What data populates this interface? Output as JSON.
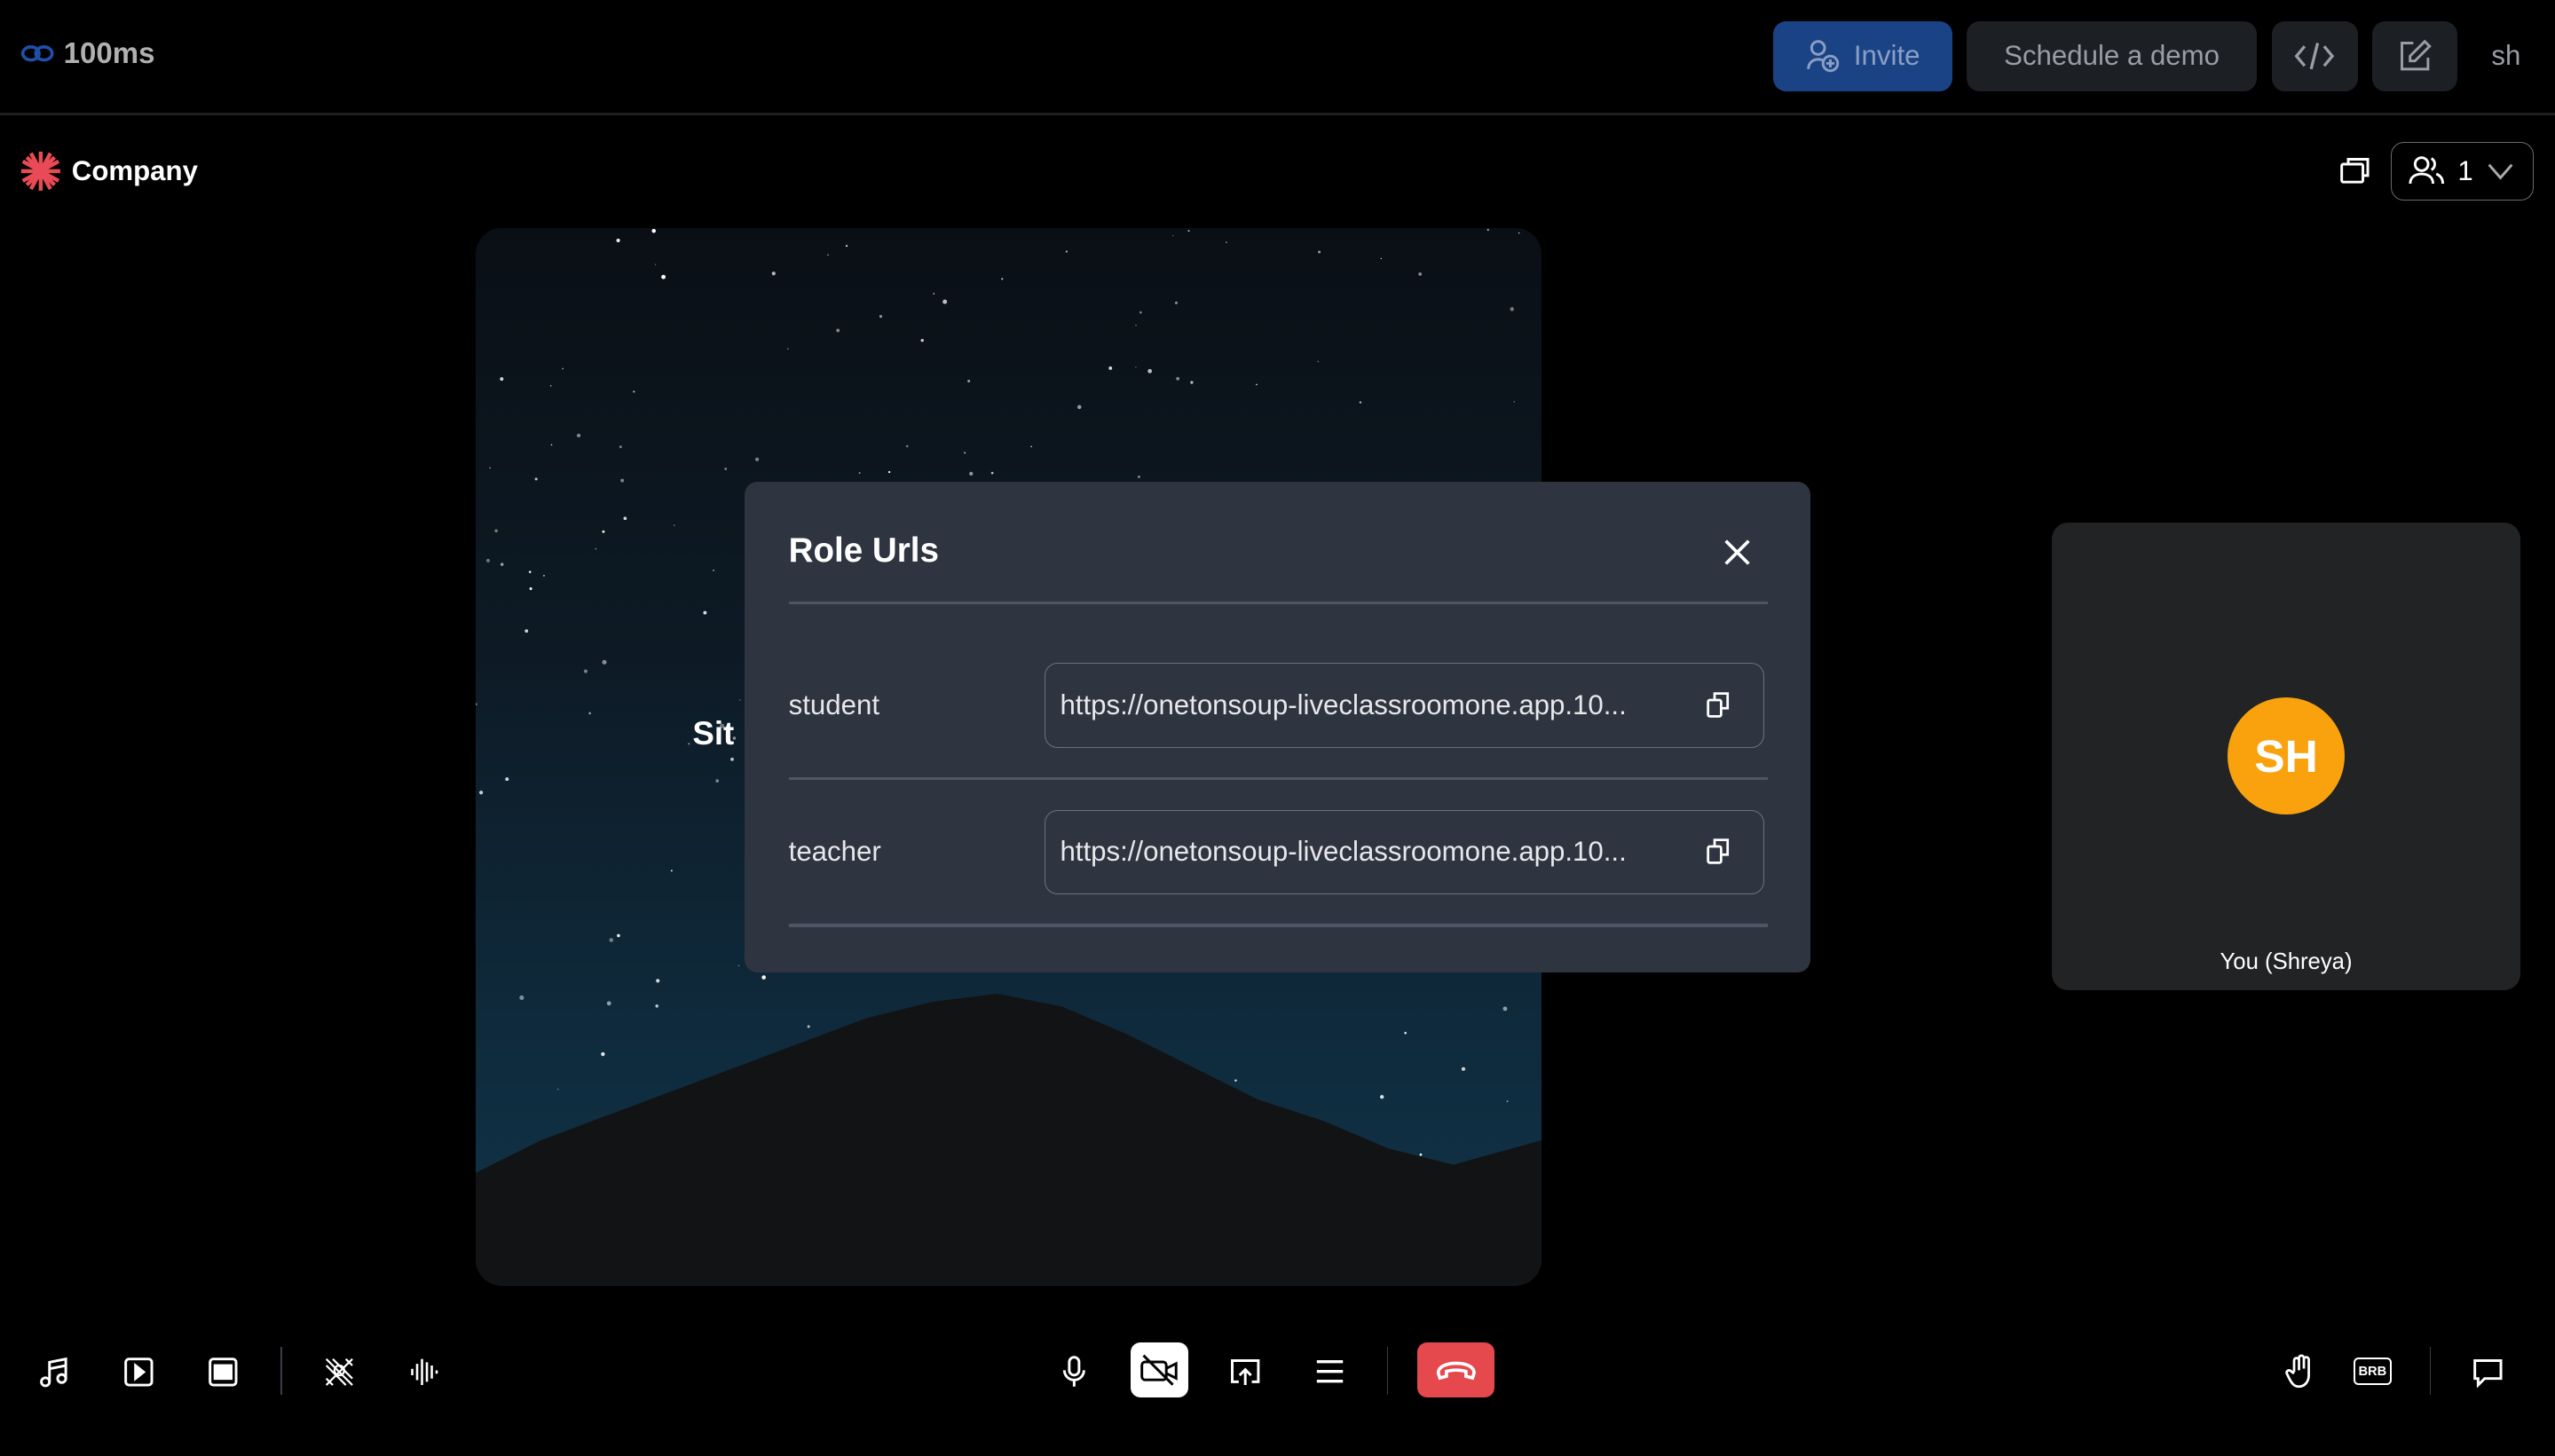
{
  "header": {
    "brand": "100ms",
    "invite_label": "Invite",
    "schedule_label": "Schedule a demo",
    "user_initials": "sh",
    "colors": {
      "invite_bg": "#1a4386",
      "button_bg": "#1c1f23"
    }
  },
  "room": {
    "company": "Company",
    "participant_count": "1"
  },
  "video_tile": {
    "name_fragment": "Sit"
  },
  "modal": {
    "title": "Role Urls",
    "roles": [
      {
        "label": "student",
        "url": "https://onetonsoup-liveclassroomone.app.10..."
      },
      {
        "label": "teacher",
        "url": "https://onetonsoup-liveclassroomone.app.10..."
      }
    ]
  },
  "self_tile": {
    "initials": "SH",
    "name": "You (Shreya)",
    "avatar_color": "#f9a20d"
  },
  "controls": {
    "leave_color": "#e5484d",
    "brb_label": "BRB"
  }
}
